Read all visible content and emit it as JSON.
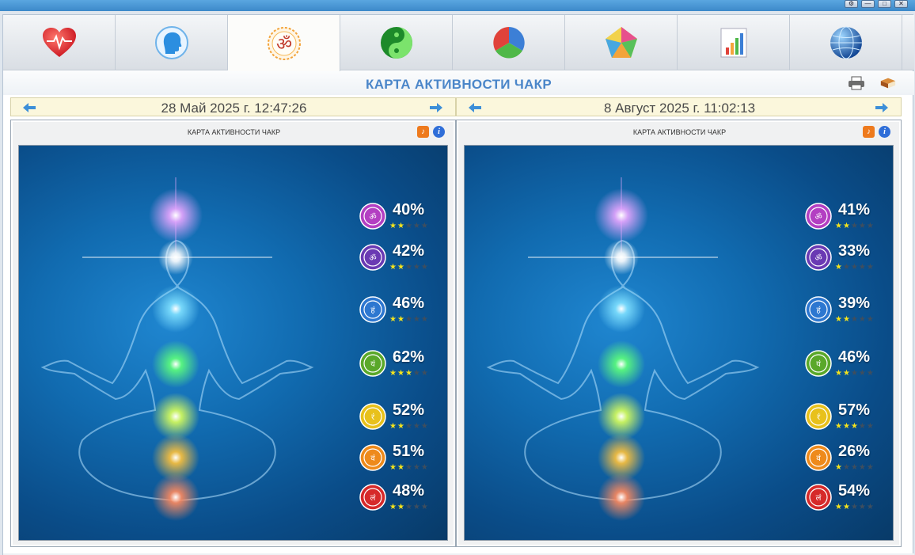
{
  "window": {
    "controls": [
      "⚙",
      "—",
      "□",
      "✕"
    ]
  },
  "tabs": [
    {
      "name": "heart",
      "active": false
    },
    {
      "name": "head",
      "active": false
    },
    {
      "name": "om",
      "active": true
    },
    {
      "name": "yin-yang",
      "active": false
    },
    {
      "name": "pie",
      "active": false
    },
    {
      "name": "pentagon",
      "active": false
    },
    {
      "name": "bar-chart",
      "active": false
    },
    {
      "name": "globe",
      "active": false
    }
  ],
  "header": {
    "title": "КАРТА АКТИВНОСТИ ЧАКР"
  },
  "colors": {
    "accent": "#4b86c9",
    "star_on": "#f5e31c",
    "star_off": "#3f4e5e",
    "date_bar": "#fbf7dc"
  },
  "panels": [
    {
      "date": "28 Май 2025 г. 12:47:26",
      "frame_title": "КАРТА АКТИВНОСТИ ЧАКР",
      "chakras": [
        {
          "name": "crown",
          "pct": "40%",
          "stars": 2
        },
        {
          "name": "third-eye",
          "pct": "42%",
          "stars": 2
        },
        {
          "name": "throat",
          "pct": "46%",
          "stars": 2
        },
        {
          "name": "heart",
          "pct": "62%",
          "stars": 3
        },
        {
          "name": "solar-plexus",
          "pct": "52%",
          "stars": 2
        },
        {
          "name": "sacral",
          "pct": "51%",
          "stars": 2
        },
        {
          "name": "root",
          "pct": "48%",
          "stars": 2
        }
      ]
    },
    {
      "date": "8 Август 2025 г. 11:02:13",
      "frame_title": "КАРТА АКТИВНОСТИ ЧАКР",
      "chakras": [
        {
          "name": "crown",
          "pct": "41%",
          "stars": 2
        },
        {
          "name": "third-eye",
          "pct": "33%",
          "stars": 1
        },
        {
          "name": "throat",
          "pct": "39%",
          "stars": 2
        },
        {
          "name": "heart",
          "pct": "46%",
          "stars": 2
        },
        {
          "name": "solar-plexus",
          "pct": "57%",
          "stars": 3
        },
        {
          "name": "sacral",
          "pct": "26%",
          "stars": 1
        },
        {
          "name": "root",
          "pct": "54%",
          "stars": 2
        }
      ]
    }
  ]
}
